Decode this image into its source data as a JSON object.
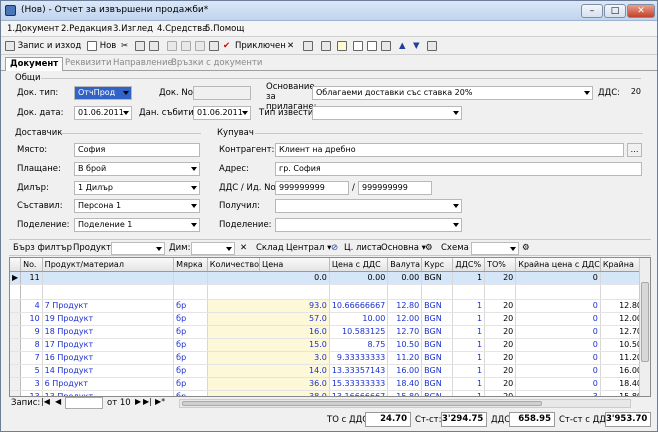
{
  "window": {
    "title": "(Нов) - Отчет за извършени продажби*"
  },
  "menu": [
    "1.Документ",
    "2.Редакция",
    "3.Изглед",
    "4.Средства",
    "5.Помощ"
  ],
  "toolbar": {
    "save_close": "Запис и изход",
    "new": "Нов",
    "confirmed": "Приключен"
  },
  "tabs": [
    "Документ",
    "Реквизити",
    "Направление",
    "Връзки с документи"
  ],
  "general": {
    "title": "Общи",
    "doc_type_label": "Док. тип:",
    "doc_type": "ОтчПрод",
    "doc_no_label": "Док. No.",
    "doc_no": "",
    "basis_label": "Основание за прилагане:",
    "basis": "Облагаеми доставки със ставка 20%",
    "vat_label": "ДДС:",
    "vat": "20",
    "doc_date_label": "Док. дата:",
    "doc_date": "01.06.2011",
    "tax_event_label": "Дан. събитие:",
    "tax_event": "01.06.2011",
    "notice_label": "Тип известие:",
    "notice": ""
  },
  "supplier": {
    "title": "Доставчик",
    "place_label": "Място:",
    "place": "София",
    "payment_label": "Плащане:",
    "payment": "В брой",
    "dealer_label": "Дилър:",
    "dealer": "1 Дилър",
    "author_label": "Съставил:",
    "author": "Персона 1",
    "division_label": "Поделение:",
    "division": "Поделение 1"
  },
  "buyer": {
    "title": "Купувач",
    "contractor_label": "Контрагент:",
    "contractor": "Клиент на дребно",
    "address_label": "Адрес:",
    "address": "гр. София",
    "vatid_label": "ДДС / Ид. No.",
    "vat_no": "999999999",
    "id_no": "999999999",
    "receiver_label": "Получил:",
    "receiver": "",
    "division_label": "Поделение:",
    "division": ""
  },
  "filterbar": {
    "quick_filter": "Бърз филтър",
    "product_label": "Продукт:",
    "dim_label": "Дим:",
    "warehouse_label": "Склад",
    "warehouse": "Централ",
    "pricelist_label": "Ц. листа",
    "pricelist": "Основна",
    "scheme_label": "Схема"
  },
  "grid": {
    "columns": [
      "No.",
      "Продукт/материал",
      "Мярка",
      "Количество",
      "Цена",
      "Цена с ДДС",
      "Валута",
      "Курс",
      "ДДС%",
      "ТО%",
      "Крайна цена с ДДС",
      "Крайна"
    ],
    "current_row": {
      "no": "11",
      "product": "",
      "unit": "",
      "qty": "0.0",
      "price": "0.00",
      "price_vat": "0.00",
      "currency": "BGN",
      "rate": "1",
      "vat": "20",
      "to": "0",
      "final": ""
    },
    "rows": [
      {
        "no": "4",
        "product": "7 Продукт",
        "unit": "бр",
        "qty": "93.0",
        "price": "10.66666667",
        "price_vat": "12.80",
        "currency": "BGN",
        "rate": "1",
        "vat": "20",
        "to": "0",
        "final": "12.80"
      },
      {
        "no": "10",
        "product": "19 Продукт",
        "unit": "бр",
        "qty": "57.0",
        "price": "10.00",
        "price_vat": "12.00",
        "currency": "BGN",
        "rate": "1",
        "vat": "20",
        "to": "0",
        "final": "12.00"
      },
      {
        "no": "9",
        "product": "18 Продукт",
        "unit": "бр",
        "qty": "16.0",
        "price": "10.583125",
        "price_vat": "12.70",
        "currency": "BGN",
        "rate": "1",
        "vat": "20",
        "to": "0",
        "final": "12.70"
      },
      {
        "no": "8",
        "product": "17 Продукт",
        "unit": "бр",
        "qty": "15.0",
        "price": "8.75",
        "price_vat": "10.50",
        "currency": "BGN",
        "rate": "1",
        "vat": "20",
        "to": "0",
        "final": "10.50"
      },
      {
        "no": "7",
        "product": "16 Продукт",
        "unit": "бр",
        "qty": "3.0",
        "price": "9.33333333",
        "price_vat": "11.20",
        "currency": "BGN",
        "rate": "1",
        "vat": "20",
        "to": "0",
        "final": "11.20"
      },
      {
        "no": "5",
        "product": "14 Продукт",
        "unit": "бр",
        "qty": "14.0",
        "price": "13.33357143",
        "price_vat": "16.00",
        "currency": "BGN",
        "rate": "1",
        "vat": "20",
        "to": "0",
        "final": "16.00"
      },
      {
        "no": "3",
        "product": "6 Продукт",
        "unit": "бр",
        "qty": "36.0",
        "price": "15.33333333",
        "price_vat": "18.40",
        "currency": "BGN",
        "rate": "1",
        "vat": "20",
        "to": "0",
        "final": "18.40"
      },
      {
        "no": "13",
        "product": "13 Продукт",
        "unit": "бр",
        "qty": "38.0",
        "price": "13.16666667",
        "price_vat": "15.80",
        "currency": "BGN",
        "rate": "1",
        "vat": "20",
        "to": "3",
        "final": "15.80"
      }
    ]
  },
  "nav": {
    "record_label": "Запис:",
    "of_label": "от 10"
  },
  "totals": {
    "to_label": "ТО с ДДС:",
    "to": "24.70",
    "st_label": "Ст-ст:",
    "st": "3'294.75",
    "vat_label": "ДДС:",
    "vat": "658.95",
    "st_vat_label": "Ст-ст с ДДС:",
    "st_vat": "3'953.70"
  }
}
